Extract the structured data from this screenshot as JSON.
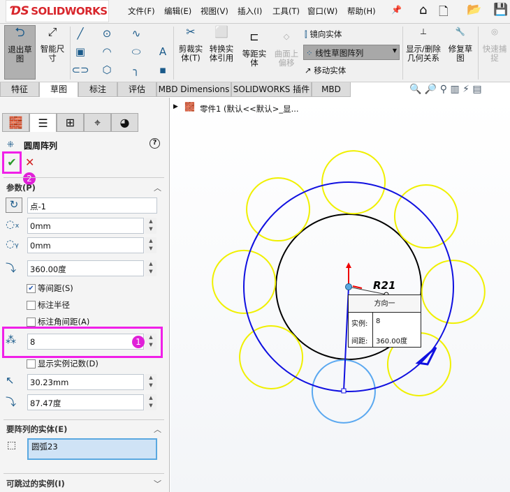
{
  "app": {
    "logo": "SOLIDWORKS"
  },
  "menu": [
    "文件(F)",
    "编辑(E)",
    "视图(V)",
    "插入(I)",
    "工具(T)",
    "窗口(W)",
    "帮助(H)"
  ],
  "ribbon": {
    "exit_sketch": "退出草图",
    "smart_dim": "智能尺寸",
    "trim": "剪裁实体(T)",
    "convert": "转换实体引用",
    "offset": "等距实体",
    "surface_offset": "曲面上偏移",
    "mirror": "镜向实体",
    "linear_pattern": "线性草图阵列",
    "move": "移动实体",
    "show_relations": "显示/删除几何关系",
    "repair": "修复草图",
    "quick_snap": "快速捕捉"
  },
  "tabs": [
    "特征",
    "草图",
    "标注",
    "评估",
    "MBD Dimensions",
    "SOLIDWORKS 插件",
    "MBD"
  ],
  "panel": {
    "title": "圆周阵列",
    "params_label": "参数(P)",
    "center": "点-1",
    "x": "0mm",
    "y": "0mm",
    "angle": "360.00度",
    "equal_spacing": "等间距(S)",
    "dim_radius": "标注半径",
    "dim_angle": "标注角间距(A)",
    "instances": "8",
    "show_count": "显示实例记数(D)",
    "radius": "30.23mm",
    "arc_angle": "87.47度",
    "entities_label": "要阵列的实体(E)",
    "entity": "圆弧23",
    "skip_label": "可跳过的实例(I)",
    "badge1": "1",
    "badge2": "2"
  },
  "tree": {
    "item": "零件1 (默认<<默认>_显..."
  },
  "canvas": {
    "dim": "R21",
    "tip_title": "方向一",
    "tip_inst_label": "实例:",
    "tip_inst": "8",
    "tip_space_label": "间距:",
    "tip_space": "360.00度"
  }
}
